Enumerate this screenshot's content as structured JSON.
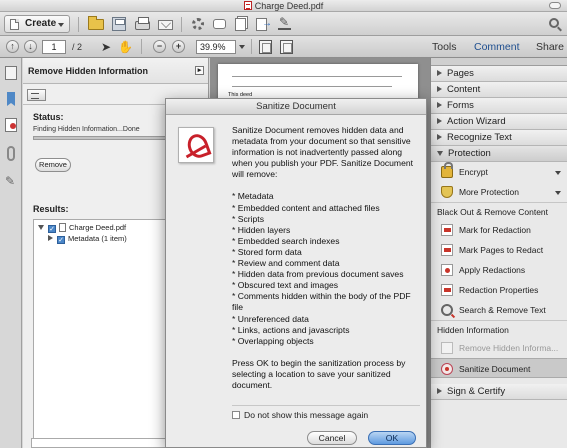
{
  "window": {
    "title": "Charge Deed.pdf"
  },
  "toolbar": {
    "create_label": "Create",
    "page_current": "1",
    "page_total": "/ 2",
    "zoom": "39.9%",
    "tabs": {
      "tools": "Tools",
      "comment": "Comment",
      "share": "Share"
    }
  },
  "left_panel": {
    "title": "Remove Hidden Information",
    "status_label": "Status:",
    "status_text": "Finding Hidden Information...Done",
    "remove_label": "Remove",
    "results_label": "Results:",
    "tree": {
      "file": "Charge Deed.pdf",
      "child": "Metadata (1 item)"
    }
  },
  "document": {
    "snippet": "This deed"
  },
  "right_panel": {
    "sections": {
      "pages": "Pages",
      "content": "Content",
      "forms": "Forms",
      "action_wizard": "Action Wizard",
      "recognize_text": "Recognize Text",
      "protection": "Protection",
      "sign_certify": "Sign & Certify"
    },
    "protection_tools": {
      "encrypt": "Encrypt",
      "more_protection": "More Protection",
      "blackout_heading": "Black Out & Remove Content",
      "mark_redaction": "Mark for Redaction",
      "mark_pages": "Mark Pages to Redact",
      "apply_redactions": "Apply Redactions",
      "redaction_properties": "Redaction Properties",
      "search_remove": "Search & Remove Text",
      "hidden_heading": "Hidden Information",
      "remove_hidden": "Remove Hidden Informa...",
      "sanitize": "Sanitize Document"
    }
  },
  "dialog": {
    "title": "Sanitize Document",
    "intro": "Sanitize Document removes hidden data and metadata from your document so that sensitive information is not inadvertently passed along when you publish your PDF. Sanitize Document will remove:",
    "items": [
      "* Metadata",
      "* Embedded content and attached files",
      "* Scripts",
      "* Hidden layers",
      "* Embedded search indexes",
      "* Stored form data",
      "* Review and comment data",
      "* Hidden data from previous document saves",
      "* Obscured text and images",
      "* Comments hidden within the body of the PDF file",
      "* Unreferenced data",
      "* Links, actions and javascripts",
      "* Overlapping objects"
    ],
    "outro": "Press OK to begin the sanitization process by selecting a location to save your sanitized document.",
    "checkbox_label": "Do not show this message again",
    "cancel_label": "Cancel",
    "ok_label": "OK"
  }
}
